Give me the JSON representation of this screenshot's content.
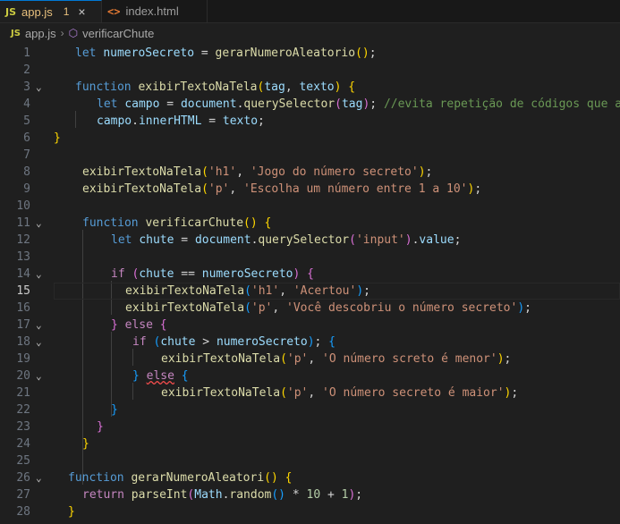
{
  "tabs": [
    {
      "icon": "JS",
      "label": "app.js",
      "problems": "1",
      "close": "×"
    },
    {
      "icon": "<>",
      "label": "index.html"
    }
  ],
  "breadcrumb": {
    "icon": "JS",
    "file": "app.js",
    "symbol": "verificarChute"
  },
  "lines": [
    {
      "n": "1",
      "indent": 24,
      "tokens": [
        [
          "kw",
          "let"
        ],
        [
          "pun",
          " "
        ],
        [
          "var",
          "numeroSecreto"
        ],
        [
          "pun",
          " = "
        ],
        [
          "fn",
          "gerarNumeroAleatorio"
        ],
        [
          "b1",
          "()"
        ],
        [
          "pun",
          ";"
        ]
      ]
    },
    {
      "n": "2",
      "indent": 0,
      "tokens": []
    },
    {
      "n": "3",
      "indent": 24,
      "fold": "v",
      "tokens": [
        [
          "kw",
          "function"
        ],
        [
          "pun",
          " "
        ],
        [
          "fn",
          "exibirTextoNaTela"
        ],
        [
          "b1",
          "("
        ],
        [
          "var",
          "tag"
        ],
        [
          "pun",
          ", "
        ],
        [
          "var",
          "texto"
        ],
        [
          "b1",
          ")"
        ],
        [
          "pun",
          " "
        ],
        [
          "b1",
          "{"
        ]
      ]
    },
    {
      "n": "4",
      "indent": 48,
      "tokens": [
        [
          "kw",
          "let"
        ],
        [
          "pun",
          " "
        ],
        [
          "var",
          "campo"
        ],
        [
          "pun",
          " = "
        ],
        [
          "var",
          "document"
        ],
        [
          "pun",
          "."
        ],
        [
          "fn",
          "querySelector"
        ],
        [
          "b2",
          "("
        ],
        [
          "var",
          "tag"
        ],
        [
          "b2",
          ")"
        ],
        [
          "pun",
          "; "
        ],
        [
          "cmt",
          "//evita repetição de códigos que alte"
        ]
      ]
    },
    {
      "n": "5",
      "indent": 48,
      "tokens": [
        [
          "var",
          "campo"
        ],
        [
          "pun",
          "."
        ],
        [
          "var",
          "innerHTML"
        ],
        [
          "pun",
          " = "
        ],
        [
          "var",
          "texto"
        ],
        [
          "pun",
          ";"
        ]
      ]
    },
    {
      "n": "6",
      "indent": 0,
      "tokens": [
        [
          "b1",
          "}"
        ]
      ]
    },
    {
      "n": "7",
      "indent": 0,
      "tokens": []
    },
    {
      "n": "8",
      "indent": 32,
      "tokens": [
        [
          "fn",
          "exibirTextoNaTela"
        ],
        [
          "b1",
          "("
        ],
        [
          "str",
          "'h1'"
        ],
        [
          "pun",
          ", "
        ],
        [
          "str",
          "'Jogo do número secreto'"
        ],
        [
          "b1",
          ")"
        ],
        [
          "pun",
          ";"
        ]
      ]
    },
    {
      "n": "9",
      "indent": 32,
      "tokens": [
        [
          "fn",
          "exibirTextoNaTela"
        ],
        [
          "b1",
          "("
        ],
        [
          "str",
          "'p'"
        ],
        [
          "pun",
          ", "
        ],
        [
          "str",
          "'Escolha um número entre 1 a 10'"
        ],
        [
          "b1",
          ")"
        ],
        [
          "pun",
          ";"
        ]
      ]
    },
    {
      "n": "10",
      "indent": 0,
      "tokens": []
    },
    {
      "n": "11",
      "indent": 32,
      "fold": "v",
      "tokens": [
        [
          "kw",
          "function"
        ],
        [
          "pun",
          " "
        ],
        [
          "fn",
          "verificarChute"
        ],
        [
          "b1",
          "()"
        ],
        [
          "pun",
          " "
        ],
        [
          "b1",
          "{"
        ]
      ]
    },
    {
      "n": "12",
      "indent": 64,
      "tokens": [
        [
          "kw",
          "let"
        ],
        [
          "pun",
          " "
        ],
        [
          "var",
          "chute"
        ],
        [
          "pun",
          " = "
        ],
        [
          "var",
          "document"
        ],
        [
          "pun",
          "."
        ],
        [
          "fn",
          "querySelector"
        ],
        [
          "b2",
          "("
        ],
        [
          "str",
          "'input'"
        ],
        [
          "b2",
          ")"
        ],
        [
          "pun",
          "."
        ],
        [
          "var",
          "value"
        ],
        [
          "pun",
          ";"
        ]
      ]
    },
    {
      "n": "13",
      "indent": 0,
      "tokens": []
    },
    {
      "n": "14",
      "indent": 64,
      "fold": "v",
      "tokens": [
        [
          "ctl",
          "if"
        ],
        [
          "pun",
          " "
        ],
        [
          "b2",
          "("
        ],
        [
          "var",
          "chute"
        ],
        [
          "pun",
          " == "
        ],
        [
          "var",
          "numeroSecreto"
        ],
        [
          "b2",
          ")"
        ],
        [
          "pun",
          " "
        ],
        [
          "b2",
          "{"
        ]
      ]
    },
    {
      "n": "15",
      "indent": 80,
      "current": true,
      "tokens": [
        [
          "fn",
          "exibirTextoNaTela"
        ],
        [
          "b3",
          "("
        ],
        [
          "str",
          "'h1'"
        ],
        [
          "pun",
          ", "
        ],
        [
          "str",
          "'Acertou'"
        ],
        [
          "b3",
          ")"
        ],
        [
          "pun",
          ";"
        ]
      ]
    },
    {
      "n": "16",
      "indent": 80,
      "tokens": [
        [
          "fn",
          "exibirTextoNaTela"
        ],
        [
          "b3",
          "("
        ],
        [
          "str",
          "'p'"
        ],
        [
          "pun",
          ", "
        ],
        [
          "str",
          "'Você descobriu o número secreto'"
        ],
        [
          "b3",
          ")"
        ],
        [
          "pun",
          ";"
        ]
      ]
    },
    {
      "n": "17",
      "indent": 64,
      "fold": "v",
      "tokens": [
        [
          "b2",
          "}"
        ],
        [
          "pun",
          " "
        ],
        [
          "ctl",
          "else"
        ],
        [
          "pun",
          " "
        ],
        [
          "b2",
          "{"
        ]
      ]
    },
    {
      "n": "18",
      "indent": 88,
      "fold": "v",
      "tokens": [
        [
          "ctl",
          "if"
        ],
        [
          "pun",
          " "
        ],
        [
          "b3",
          "("
        ],
        [
          "var",
          "chute"
        ],
        [
          "pun",
          " > "
        ],
        [
          "var",
          "numeroSecreto"
        ],
        [
          "b3",
          ")"
        ],
        [
          "pun",
          "; "
        ],
        [
          "b3",
          "{"
        ]
      ]
    },
    {
      "n": "19",
      "indent": 120,
      "tokens": [
        [
          "fn",
          "exibirTextoNaTela"
        ],
        [
          "b1",
          "("
        ],
        [
          "str",
          "'p'"
        ],
        [
          "pun",
          ", "
        ],
        [
          "str",
          "'O número screto é menor'"
        ],
        [
          "b1",
          ")"
        ],
        [
          "pun",
          ";"
        ]
      ]
    },
    {
      "n": "20",
      "indent": 88,
      "fold": "v",
      "tokens": [
        [
          "b3",
          "}"
        ],
        [
          "pun",
          " "
        ],
        [
          "ctl",
          "else"
        ],
        [
          "pun",
          " "
        ],
        [
          "b3",
          "{"
        ]
      ]
    },
    {
      "n": "21",
      "indent": 120,
      "tokens": [
        [
          "fn",
          "exibirTextoNaTela"
        ],
        [
          "b1",
          "("
        ],
        [
          "str",
          "'p'"
        ],
        [
          "pun",
          ", "
        ],
        [
          "str",
          "'O número secreto é maior'"
        ],
        [
          "b1",
          ")"
        ],
        [
          "pun",
          ";"
        ]
      ]
    },
    {
      "n": "22",
      "indent": 64,
      "tokens": [
        [
          "b3",
          "}"
        ]
      ]
    },
    {
      "n": "23",
      "indent": 48,
      "tokens": [
        [
          "b2",
          "}"
        ]
      ]
    },
    {
      "n": "24",
      "indent": 32,
      "tokens": [
        [
          "b1",
          "}"
        ]
      ]
    },
    {
      "n": "25",
      "indent": 0,
      "tokens": []
    },
    {
      "n": "26",
      "indent": 16,
      "fold": "v",
      "tokens": [
        [
          "kw",
          "function"
        ],
        [
          "pun",
          " "
        ],
        [
          "fn",
          "gerarNumeroAleatori"
        ],
        [
          "b1",
          "()"
        ],
        [
          "pun",
          " "
        ],
        [
          "b1",
          "{"
        ]
      ]
    },
    {
      "n": "27",
      "indent": 32,
      "tokens": [
        [
          "ctl",
          "return"
        ],
        [
          "pun",
          " "
        ],
        [
          "fn",
          "parseInt"
        ],
        [
          "b2",
          "("
        ],
        [
          "var",
          "Math"
        ],
        [
          "pun",
          "."
        ],
        [
          "fn",
          "random"
        ],
        [
          "b3",
          "()"
        ],
        [
          "pun",
          " * "
        ],
        [
          "num",
          "10"
        ],
        [
          "pun",
          " + "
        ],
        [
          "num",
          "1"
        ],
        [
          "b2",
          ")"
        ],
        [
          "pun",
          ";"
        ]
      ]
    },
    {
      "n": "28",
      "indent": 16,
      "tokens": [
        [
          "b1",
          "}"
        ]
      ]
    }
  ]
}
